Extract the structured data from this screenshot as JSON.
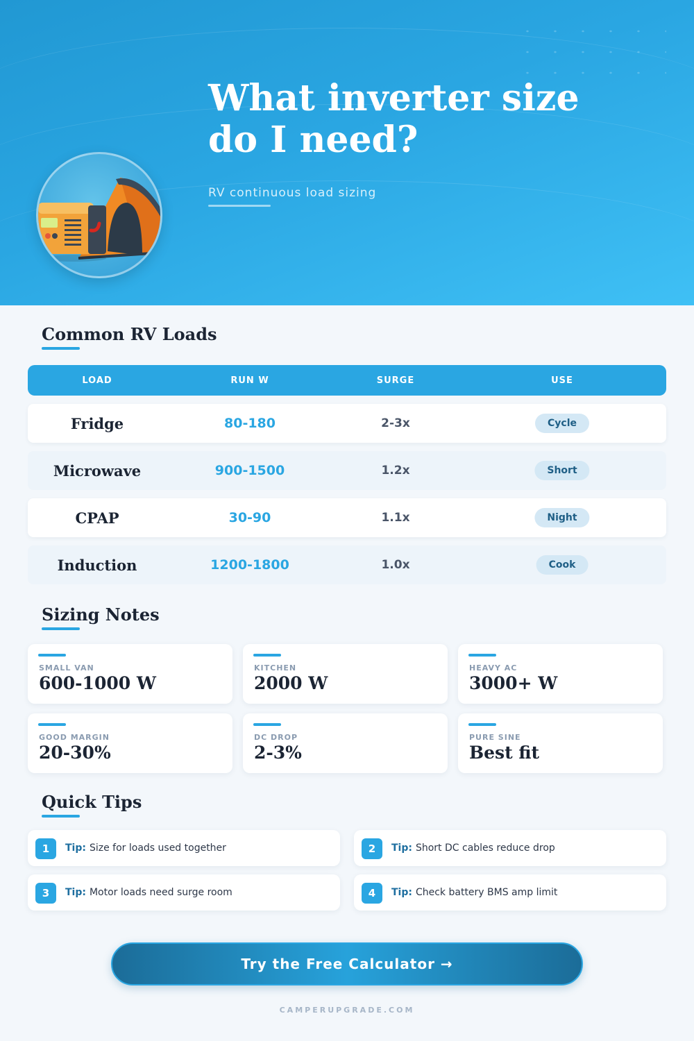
{
  "hero": {
    "title_line1": "What inverter size",
    "title_line2": "do I need?",
    "subtitle": "RV continuous load sizing"
  },
  "loads_section": {
    "title": "Common RV Loads",
    "columns": [
      "LOAD",
      "RUN W",
      "SURGE",
      "USE"
    ],
    "rows": [
      {
        "load": "Fridge",
        "run_w": "80-180",
        "surge": "2-3x",
        "use": "Cycle"
      },
      {
        "load": "Microwave",
        "run_w": "900-1500",
        "surge": "1.2x",
        "use": "Short"
      },
      {
        "load": "CPAP",
        "run_w": "30-90",
        "surge": "1.1x",
        "use": "Night"
      },
      {
        "load": "Induction",
        "run_w": "1200-1800",
        "surge": "1.0x",
        "use": "Cook"
      }
    ]
  },
  "notes_section": {
    "title": "Sizing Notes",
    "cards": [
      {
        "label": "SMALL VAN",
        "value": "600-1000 W"
      },
      {
        "label": "KITCHEN",
        "value": "2000 W"
      },
      {
        "label": "HEAVY AC",
        "value": "3000+ W"
      },
      {
        "label": "GOOD MARGIN",
        "value": "20-30%"
      },
      {
        "label": "DC DROP",
        "value": "2-3%"
      },
      {
        "label": "PURE SINE",
        "value": "Best fit"
      }
    ]
  },
  "tips_section": {
    "title": "Quick Tips",
    "prefix": "Tip:",
    "tips": [
      {
        "num": "1",
        "text": "Size for loads used together"
      },
      {
        "num": "2",
        "text": "Short DC cables reduce drop"
      },
      {
        "num": "3",
        "text": "Motor loads need surge room"
      },
      {
        "num": "4",
        "text": "Check battery BMS amp limit"
      }
    ]
  },
  "cta": {
    "label": "Try the Free Calculator →"
  },
  "footer": {
    "site": "CAMPERUPGRADE.COM"
  },
  "colors": {
    "accent": "#2aa6e2",
    "hero_start": "#2198d3",
    "hero_end": "#3fc0f5",
    "cta_dark": "#1b6c98"
  },
  "icons": {
    "illustration": "inverter-tent-illustration"
  }
}
